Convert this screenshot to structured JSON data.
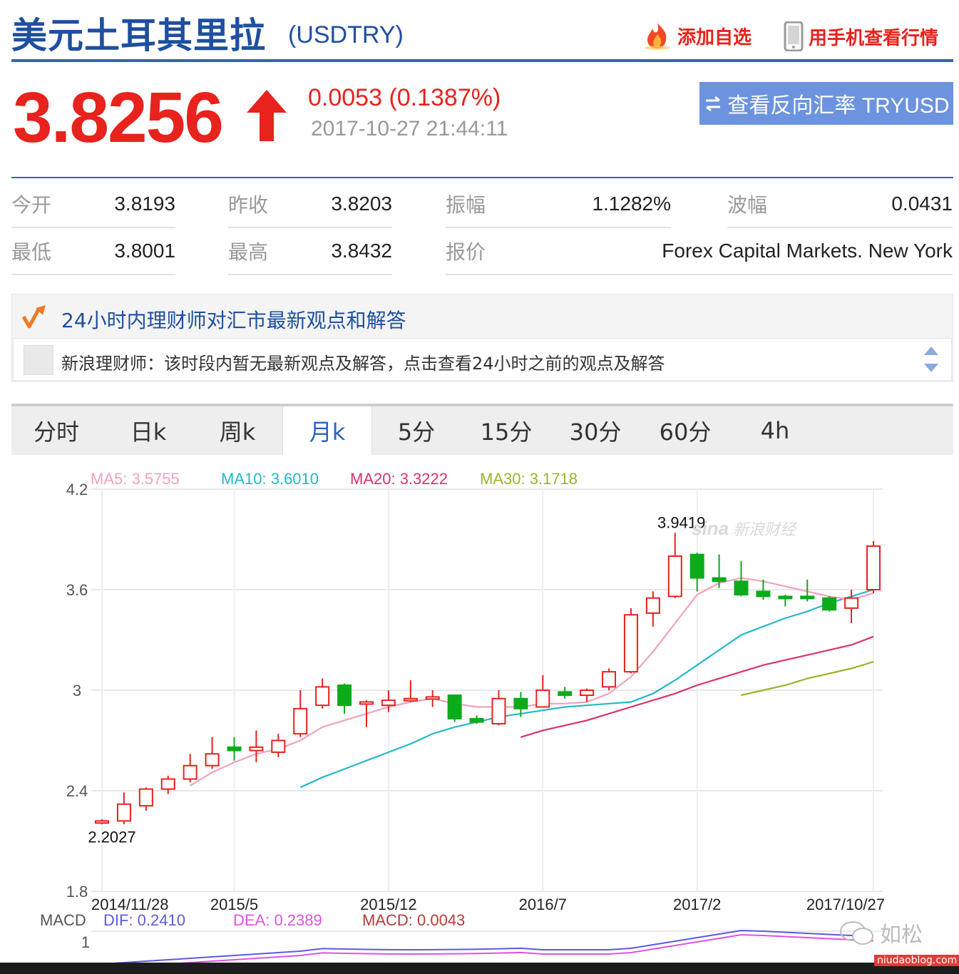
{
  "header": {
    "title": "美元土耳其里拉",
    "code": "(USDTRY)",
    "add_watch": "添加自选",
    "mobile_view": "用手机查看行情"
  },
  "quote": {
    "price": "3.8256",
    "change": "0.0053 (0.1387%)",
    "time": "2017-10-27 21:44:11",
    "reverse_button": "查看反向汇率 TRYUSD",
    "direction": "up"
  },
  "stats": [
    {
      "label": "今开",
      "value": "3.8193"
    },
    {
      "label": "昨收",
      "value": "3.8203"
    },
    {
      "label": "振幅",
      "value": "1.1282%"
    },
    {
      "label": "波幅",
      "value": "0.0431"
    },
    {
      "label": "最低",
      "value": "3.8001"
    },
    {
      "label": "最高",
      "value": "3.8432"
    },
    {
      "label": "报价",
      "value": "Forex Capital Markets. New York"
    }
  ],
  "advisor": {
    "title": "24小时内理财师对汇市最新观点和解答",
    "message": "新浪理财师：该时段内暂无最新观点及解答，点击查看24小时之前的观点及解答"
  },
  "tabs": [
    "分时",
    "日k",
    "周k",
    "月k",
    "5分",
    "15分",
    "30分",
    "60分",
    "4h"
  ],
  "active_tab": "月k",
  "colors": {
    "up": "#e8221c",
    "down": "#0bab1b",
    "ma5": "#f2a1c0",
    "ma10": "#25b8cc",
    "ma20": "#d8336e",
    "ma30": "#98b62c",
    "dif": "#5b5be0",
    "dea": "#e052e0",
    "brand_blue": "#1e4fa0"
  },
  "chart_data": {
    "type": "candlestick",
    "legend": {
      "ma5": "MA5: 3.5755",
      "ma10": "MA10: 3.6010",
      "ma20": "MA20: 3.3222",
      "ma30": "MA30: 3.1718"
    },
    "ylim": [
      1.8,
      4.2
    ],
    "yticks": [
      "4.2",
      "3.6",
      "3",
      "2.4",
      "1.8"
    ],
    "ytick_values": [
      4.2,
      3.6,
      3.0,
      2.4,
      1.8
    ],
    "xticks": [
      {
        "label": "2014/11/28",
        "index": 0
      },
      {
        "label": "2015/5",
        "index": 6
      },
      {
        "label": "2015/12",
        "index": 13
      },
      {
        "label": "2016/7",
        "index": 20
      },
      {
        "label": "2017/2",
        "index": 27
      },
      {
        "label": "2017/10/27",
        "index": 35
      }
    ],
    "annotations": [
      {
        "text": "3.9419",
        "index": 27,
        "value": 3.9419
      },
      {
        "text": "2.2027",
        "index": 0,
        "value": 2.2027
      }
    ],
    "candles": [
      [
        2.21,
        2.22,
        2.2,
        2.23
      ],
      [
        2.22,
        2.32,
        2.2,
        2.39
      ],
      [
        2.31,
        2.41,
        2.28,
        2.42
      ],
      [
        2.41,
        2.47,
        2.38,
        2.49
      ],
      [
        2.47,
        2.55,
        2.45,
        2.62
      ],
      [
        2.55,
        2.62,
        2.53,
        2.72
      ],
      [
        2.66,
        2.64,
        2.58,
        2.72
      ],
      [
        2.64,
        2.66,
        2.57,
        2.76
      ],
      [
        2.63,
        2.7,
        2.6,
        2.74
      ],
      [
        2.74,
        2.89,
        2.72,
        3.0
      ],
      [
        2.91,
        3.02,
        2.89,
        3.07
      ],
      [
        3.03,
        2.91,
        2.86,
        3.04
      ],
      [
        2.93,
        2.93,
        2.78,
        2.94
      ],
      [
        2.91,
        2.94,
        2.87,
        3.0
      ],
      [
        2.94,
        2.95,
        2.93,
        3.06
      ],
      [
        2.95,
        2.96,
        2.9,
        3.0
      ],
      [
        2.97,
        2.83,
        2.81,
        2.97
      ],
      [
        2.83,
        2.81,
        2.8,
        2.85
      ],
      [
        2.8,
        2.95,
        2.79,
        3.0
      ],
      [
        2.95,
        2.89,
        2.84,
        2.99
      ],
      [
        2.9,
        3.0,
        2.9,
        3.09
      ],
      [
        2.99,
        2.97,
        2.95,
        3.02
      ],
      [
        2.97,
        3.0,
        2.93,
        3.01
      ],
      [
        3.02,
        3.11,
        3.0,
        3.13
      ],
      [
        3.11,
        3.45,
        3.1,
        3.49
      ],
      [
        3.46,
        3.55,
        3.38,
        3.59
      ],
      [
        3.56,
        3.8,
        3.55,
        3.94
      ],
      [
        3.81,
        3.67,
        3.59,
        3.82
      ],
      [
        3.67,
        3.65,
        3.61,
        3.81
      ],
      [
        3.65,
        3.57,
        3.56,
        3.77
      ],
      [
        3.59,
        3.56,
        3.54,
        3.66
      ],
      [
        3.56,
        3.55,
        3.5,
        3.57
      ],
      [
        3.56,
        3.55,
        3.53,
        3.66
      ],
      [
        3.55,
        3.48,
        3.47,
        3.56
      ],
      [
        3.49,
        3.55,
        3.4,
        3.6
      ],
      [
        3.6,
        3.86,
        3.58,
        3.89
      ]
    ],
    "ma5": [
      null,
      null,
      null,
      null,
      2.43,
      2.51,
      2.57,
      2.62,
      2.65,
      2.7,
      2.78,
      2.82,
      2.86,
      2.9,
      2.93,
      2.95,
      2.92,
      2.9,
      2.9,
      2.9,
      2.92,
      2.92,
      2.93,
      2.98,
      3.08,
      3.23,
      3.4,
      3.57,
      3.64,
      3.67,
      3.65,
      3.62,
      3.59,
      3.56,
      3.54,
      3.58
    ],
    "ma10": [
      null,
      null,
      null,
      null,
      null,
      null,
      null,
      null,
      null,
      2.42,
      2.48,
      2.53,
      2.58,
      2.63,
      2.68,
      2.74,
      2.78,
      2.81,
      2.84,
      2.86,
      2.88,
      2.9,
      2.91,
      2.92,
      2.93,
      2.98,
      3.06,
      3.15,
      3.24,
      3.33,
      3.38,
      3.43,
      3.47,
      3.52,
      3.56,
      3.6
    ],
    "ma20": [
      null,
      null,
      null,
      null,
      null,
      null,
      null,
      null,
      null,
      null,
      null,
      null,
      null,
      null,
      null,
      null,
      null,
      null,
      null,
      2.72,
      2.76,
      2.79,
      2.82,
      2.86,
      2.9,
      2.94,
      2.98,
      3.03,
      3.07,
      3.11,
      3.15,
      3.18,
      3.21,
      3.24,
      3.27,
      3.32
    ],
    "ma30": [
      null,
      null,
      null,
      null,
      null,
      null,
      null,
      null,
      null,
      null,
      null,
      null,
      null,
      null,
      null,
      null,
      null,
      null,
      null,
      null,
      null,
      null,
      null,
      null,
      null,
      null,
      null,
      null,
      null,
      2.97,
      3.0,
      3.03,
      3.07,
      3.1,
      3.13,
      3.17
    ],
    "macd_legend": {
      "label": "MACD",
      "dif": "DIF: 0.2410",
      "dea": "DEA: 0.2389",
      "macd": "MACD: 0.0043"
    },
    "macd_ytick": "1"
  }
}
